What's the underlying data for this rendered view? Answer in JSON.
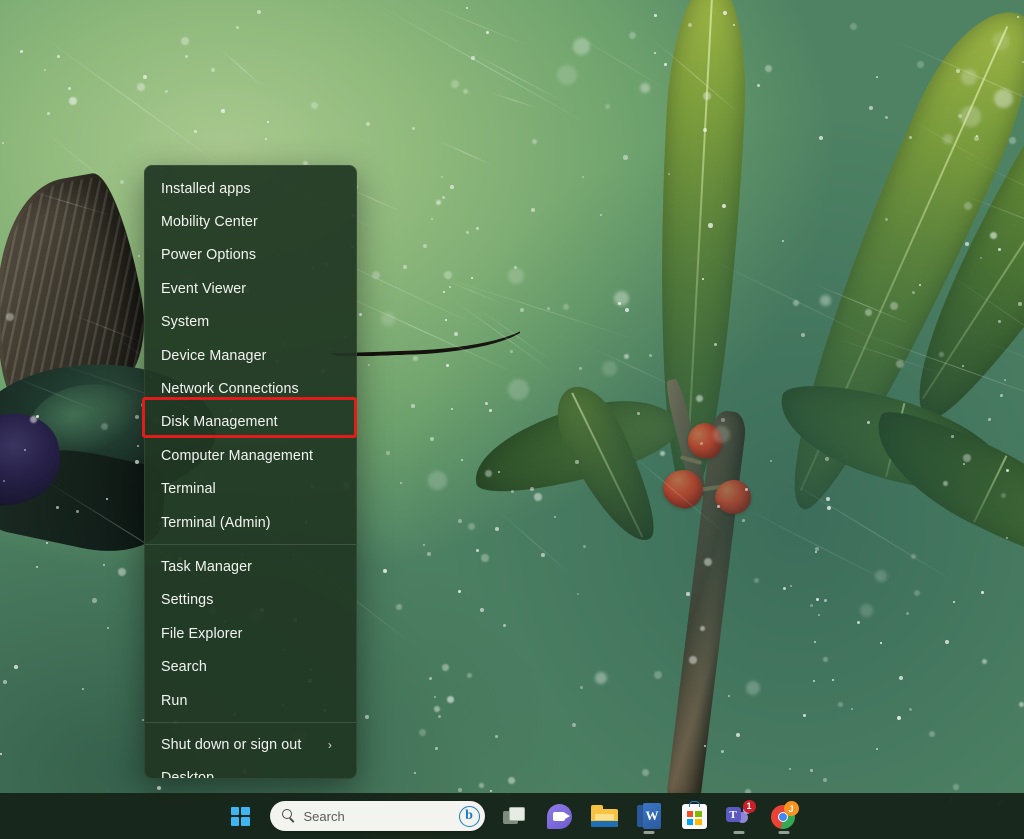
{
  "desktop": {
    "wallpaper_description": "Hummingbird and red flower buds in rain on green background",
    "colors": {
      "menu_background": "#203722",
      "menu_text": "#f2f4f2",
      "highlight_border": "#e21b1b",
      "taskbar_background": "#172419",
      "accent_blue": "#3fb6f2",
      "search_pill": "#f3f3ef"
    }
  },
  "context_menu": {
    "name": "Power User Menu",
    "groups": [
      {
        "items": [
          {
            "label": "Installed apps",
            "submenu": false
          },
          {
            "label": "Mobility Center",
            "submenu": false
          },
          {
            "label": "Power Options",
            "submenu": false
          },
          {
            "label": "Event Viewer",
            "submenu": false
          },
          {
            "label": "System",
            "submenu": false
          },
          {
            "label": "Device Manager",
            "submenu": false
          },
          {
            "label": "Network Connections",
            "submenu": false
          },
          {
            "label": "Disk Management",
            "submenu": false,
            "highlighted": true
          },
          {
            "label": "Computer Management",
            "submenu": false
          },
          {
            "label": "Terminal",
            "submenu": false
          },
          {
            "label": "Terminal (Admin)",
            "submenu": false
          }
        ]
      },
      {
        "items": [
          {
            "label": "Task Manager",
            "submenu": false
          },
          {
            "label": "Settings",
            "submenu": false
          },
          {
            "label": "File Explorer",
            "submenu": false
          },
          {
            "label": "Search",
            "submenu": false
          },
          {
            "label": "Run",
            "submenu": false
          }
        ]
      },
      {
        "items": [
          {
            "label": "Shut down or sign out",
            "submenu": true,
            "chevron": "›"
          },
          {
            "label": "Desktop",
            "submenu": false
          }
        ]
      }
    ]
  },
  "taskbar": {
    "start_button": {
      "name": "Start",
      "icon": "windows-logo-icon"
    },
    "search": {
      "placeholder": "Search",
      "value": "",
      "icon": "search-icon",
      "trailing_icon": "bing-copilot-icon",
      "bing_glyph": "b"
    },
    "buttons": [
      {
        "name": "task-view",
        "icon": "task-view-icon",
        "label": "Task view",
        "running": false
      },
      {
        "name": "chat",
        "icon": "chat-camera-icon",
        "label": "Chat",
        "running": false
      },
      {
        "name": "file-explorer",
        "icon": "folder-icon",
        "label": "File Explorer",
        "running": false
      },
      {
        "name": "word",
        "icon": "word-icon",
        "label": "Word",
        "glyph": "W",
        "running": true
      },
      {
        "name": "microsoft-store",
        "icon": "store-icon",
        "label": "Microsoft Store",
        "running": false
      },
      {
        "name": "teams",
        "icon": "teams-icon",
        "label": "Microsoft Teams",
        "glyph": "T",
        "badge": "1",
        "running": true
      },
      {
        "name": "chrome",
        "icon": "chrome-icon",
        "label": "Google Chrome",
        "badge_glyph": "J",
        "running": true
      }
    ]
  }
}
